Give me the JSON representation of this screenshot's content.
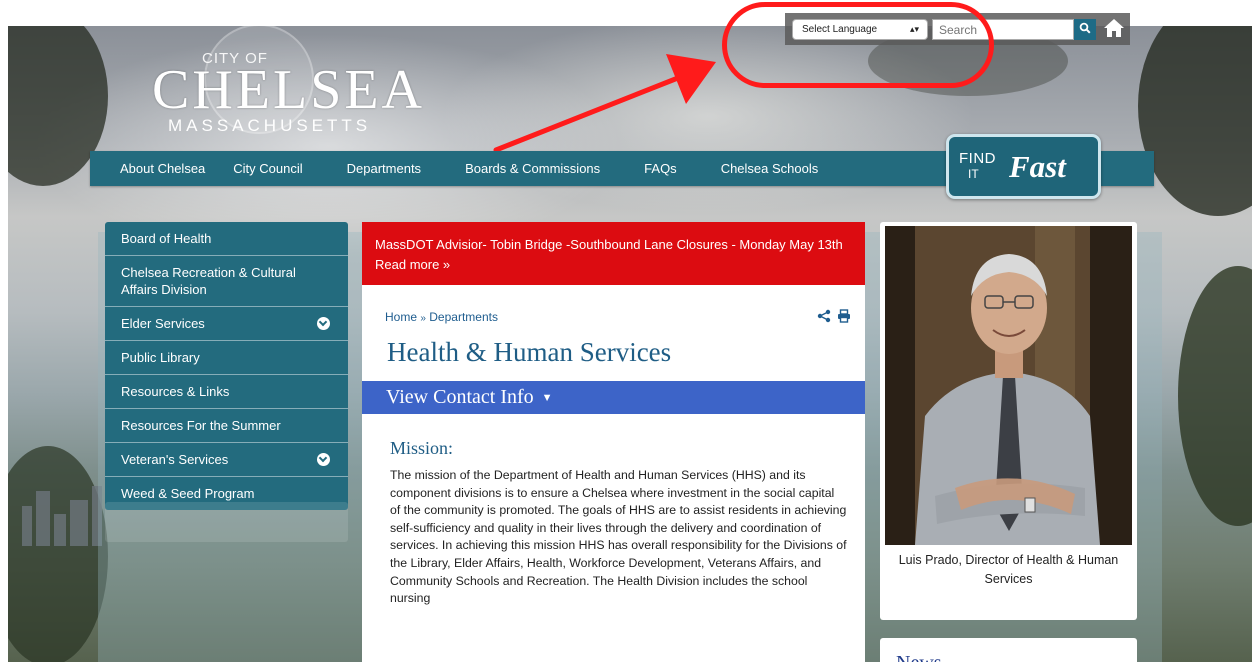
{
  "logo": {
    "city": "CITY OF",
    "name": "CHELSEA",
    "state": "MASSACHUSETTS"
  },
  "utility": {
    "language_select": "Select Language",
    "search_placeholder": "Search"
  },
  "nav": {
    "items": [
      "About Chelsea",
      "City Council",
      "Departments",
      "Boards & Commissions",
      "FAQs",
      "Chelsea Schools"
    ]
  },
  "find_it_fast": {
    "find": "FIND",
    "it": "IT",
    "fast": "Fast"
  },
  "sidebar": {
    "items": [
      {
        "label": "Board of Health"
      },
      {
        "label": "Chelsea Recreation & Cultural Affairs Division"
      },
      {
        "label": "Elder Services"
      },
      {
        "label": "Public Library"
      },
      {
        "label": "Resources & Links"
      },
      {
        "label": "Resources For the Summer"
      },
      {
        "label": "Veteran's Services"
      },
      {
        "label": "Weed & Seed Program"
      }
    ]
  },
  "alert": {
    "text": "MassDOT Advisior- Tobin Bridge -Southbound Lane Closures - Monday May 13th Read more »"
  },
  "breadcrumb": {
    "home": "Home",
    "separator": "»",
    "current": "Departments"
  },
  "page": {
    "title": "Health & Human Services",
    "contact_label": "View Contact Info",
    "contact_toggle": "▼",
    "mission_heading": "Mission:",
    "mission_text": "The mission of the Department of Health and Human Services (HHS) and its component divisions is to ensure a Chelsea where investment in the social capital of the community is promoted. The goals of HHS are to as­sist residents in achieving self-sufficiency and quality in their lives through the delivery and coordination of services. In achieving this mis­sion HHS has overall responsibility for the Divisions of the Library, Elder Affairs, Health, Workforce Development, Veterans Affairs, and Community Schools and Recreation. The Health Division includes the school nursing"
  },
  "photo": {
    "caption": "Luis Prado, Director of Health & Human Services"
  },
  "news": {
    "heading": "News"
  },
  "colors": {
    "nav_teal": "#236b7e",
    "alert_red": "#dc0c11",
    "contact_blue": "#3d64c8",
    "title_blue": "#1f5d85",
    "annotation_red": "#ff1b1b"
  }
}
